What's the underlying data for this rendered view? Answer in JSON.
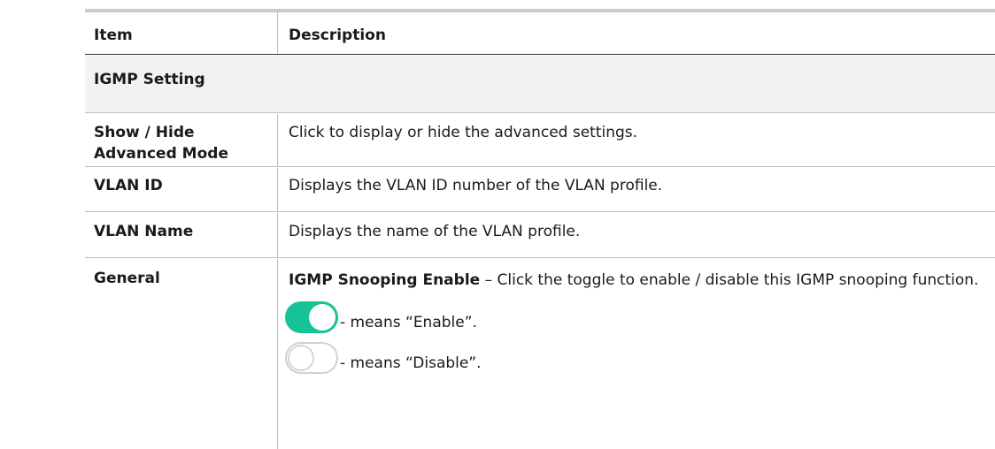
{
  "table": {
    "header": {
      "item": "Item",
      "description": "Description"
    },
    "section": "IGMP Setting",
    "rows": {
      "advanced": {
        "item": "Show / Hide Advanced Mode",
        "description": "Click to display or hide the advanced settings."
      },
      "vlan_id": {
        "item": "VLAN ID",
        "description": "Displays the VLAN ID number of the VLAN profile."
      },
      "vlan_name": {
        "item": "VLAN Name",
        "description": "Displays the name of the VLAN profile."
      },
      "general": {
        "item": "General",
        "term": "IGMP Snooping Enable",
        "dash": " – ",
        "description": "Click the toggle to enable / disable this IGMP snooping function.",
        "enable_text": "- means “Enable”.",
        "disable_text": "- means “Disable”."
      }
    }
  },
  "colors": {
    "toggle_on": "#17c296",
    "toggle_off_border": "#d0d0d0",
    "section_bg": "#f2f2f2",
    "table_top_rule": "#c9c9c9"
  }
}
